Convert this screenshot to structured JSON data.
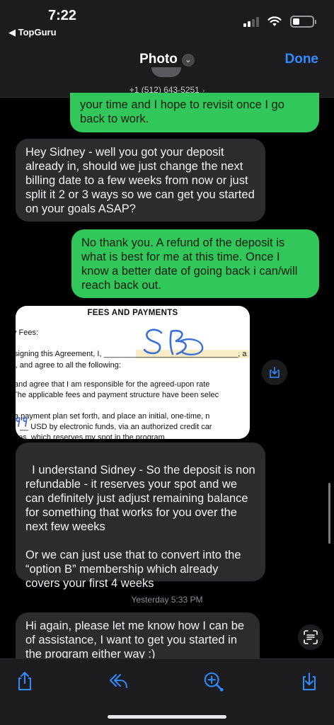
{
  "status_bar": {
    "time": "7:22",
    "back_app": "◀ TopGuru",
    "icons": [
      "cellular-signal-icon",
      "wifi-icon",
      "battery-icon"
    ]
  },
  "nav": {
    "title": "Photo",
    "done_label": "Done",
    "phone": "+1 (512) 643-5251",
    "chevron": "›"
  },
  "messages": [
    {
      "type": "sent",
      "text": "your time and I hope to revisit once I go back to work."
    },
    {
      "type": "received",
      "text": "Hey Sidney - well you got your deposit already in, should we just change the next billing date to a few weeks from now or just split it 2 or 3 ways so we can get you started on your goals ASAP?"
    },
    {
      "type": "sent",
      "text": "No thank you.  A refund of the deposit is what is best for me at this time. Once I know a better date of going back i can/will reach back out."
    },
    {
      "type": "received",
      "text": "I understand Sidney - So the deposit is non refundable - it reserves your spot and we can definitely just adjust remaining balance for something that works for you over the next few weeks\n\nOr we can just use that to convert into the “option B” membership which already covers your first 4 weeks"
    },
    {
      "type": "received",
      "text": "Hi again, please let me know how I can be of assistance, I want to get you started in the program either way :)"
    }
  ],
  "attachment": {
    "title": "FEES AND PAYMENTS",
    "lines": [
      "y Fees:",
      "signing this Agreement, I, _______________________________, a",
      "), and agree to all the following:",
      "and agree that I am responsible for the agreed-upon rate",
      "The applicable fees and payment structure have been selec",
      "a payment plan set forth, and place an initial, one-time, n",
      "__ USD by electronic funds, via an authorized credit car",
      "ges, which reserves my spot in the program."
    ],
    "handwritten_initials": "SB",
    "handwritten_amount": "99"
  },
  "timestamp": "Yesterday 5:33 PM",
  "toolbar": {
    "buttons": [
      "share-icon",
      "reply-icon",
      "zoom-icon",
      "save-icon"
    ],
    "accent": "#2f8bff"
  },
  "colors": {
    "sent_bubble": "#31c75a",
    "received_bubble": "#2c2c2e",
    "background": "#000000",
    "accent": "#2f8bff"
  }
}
